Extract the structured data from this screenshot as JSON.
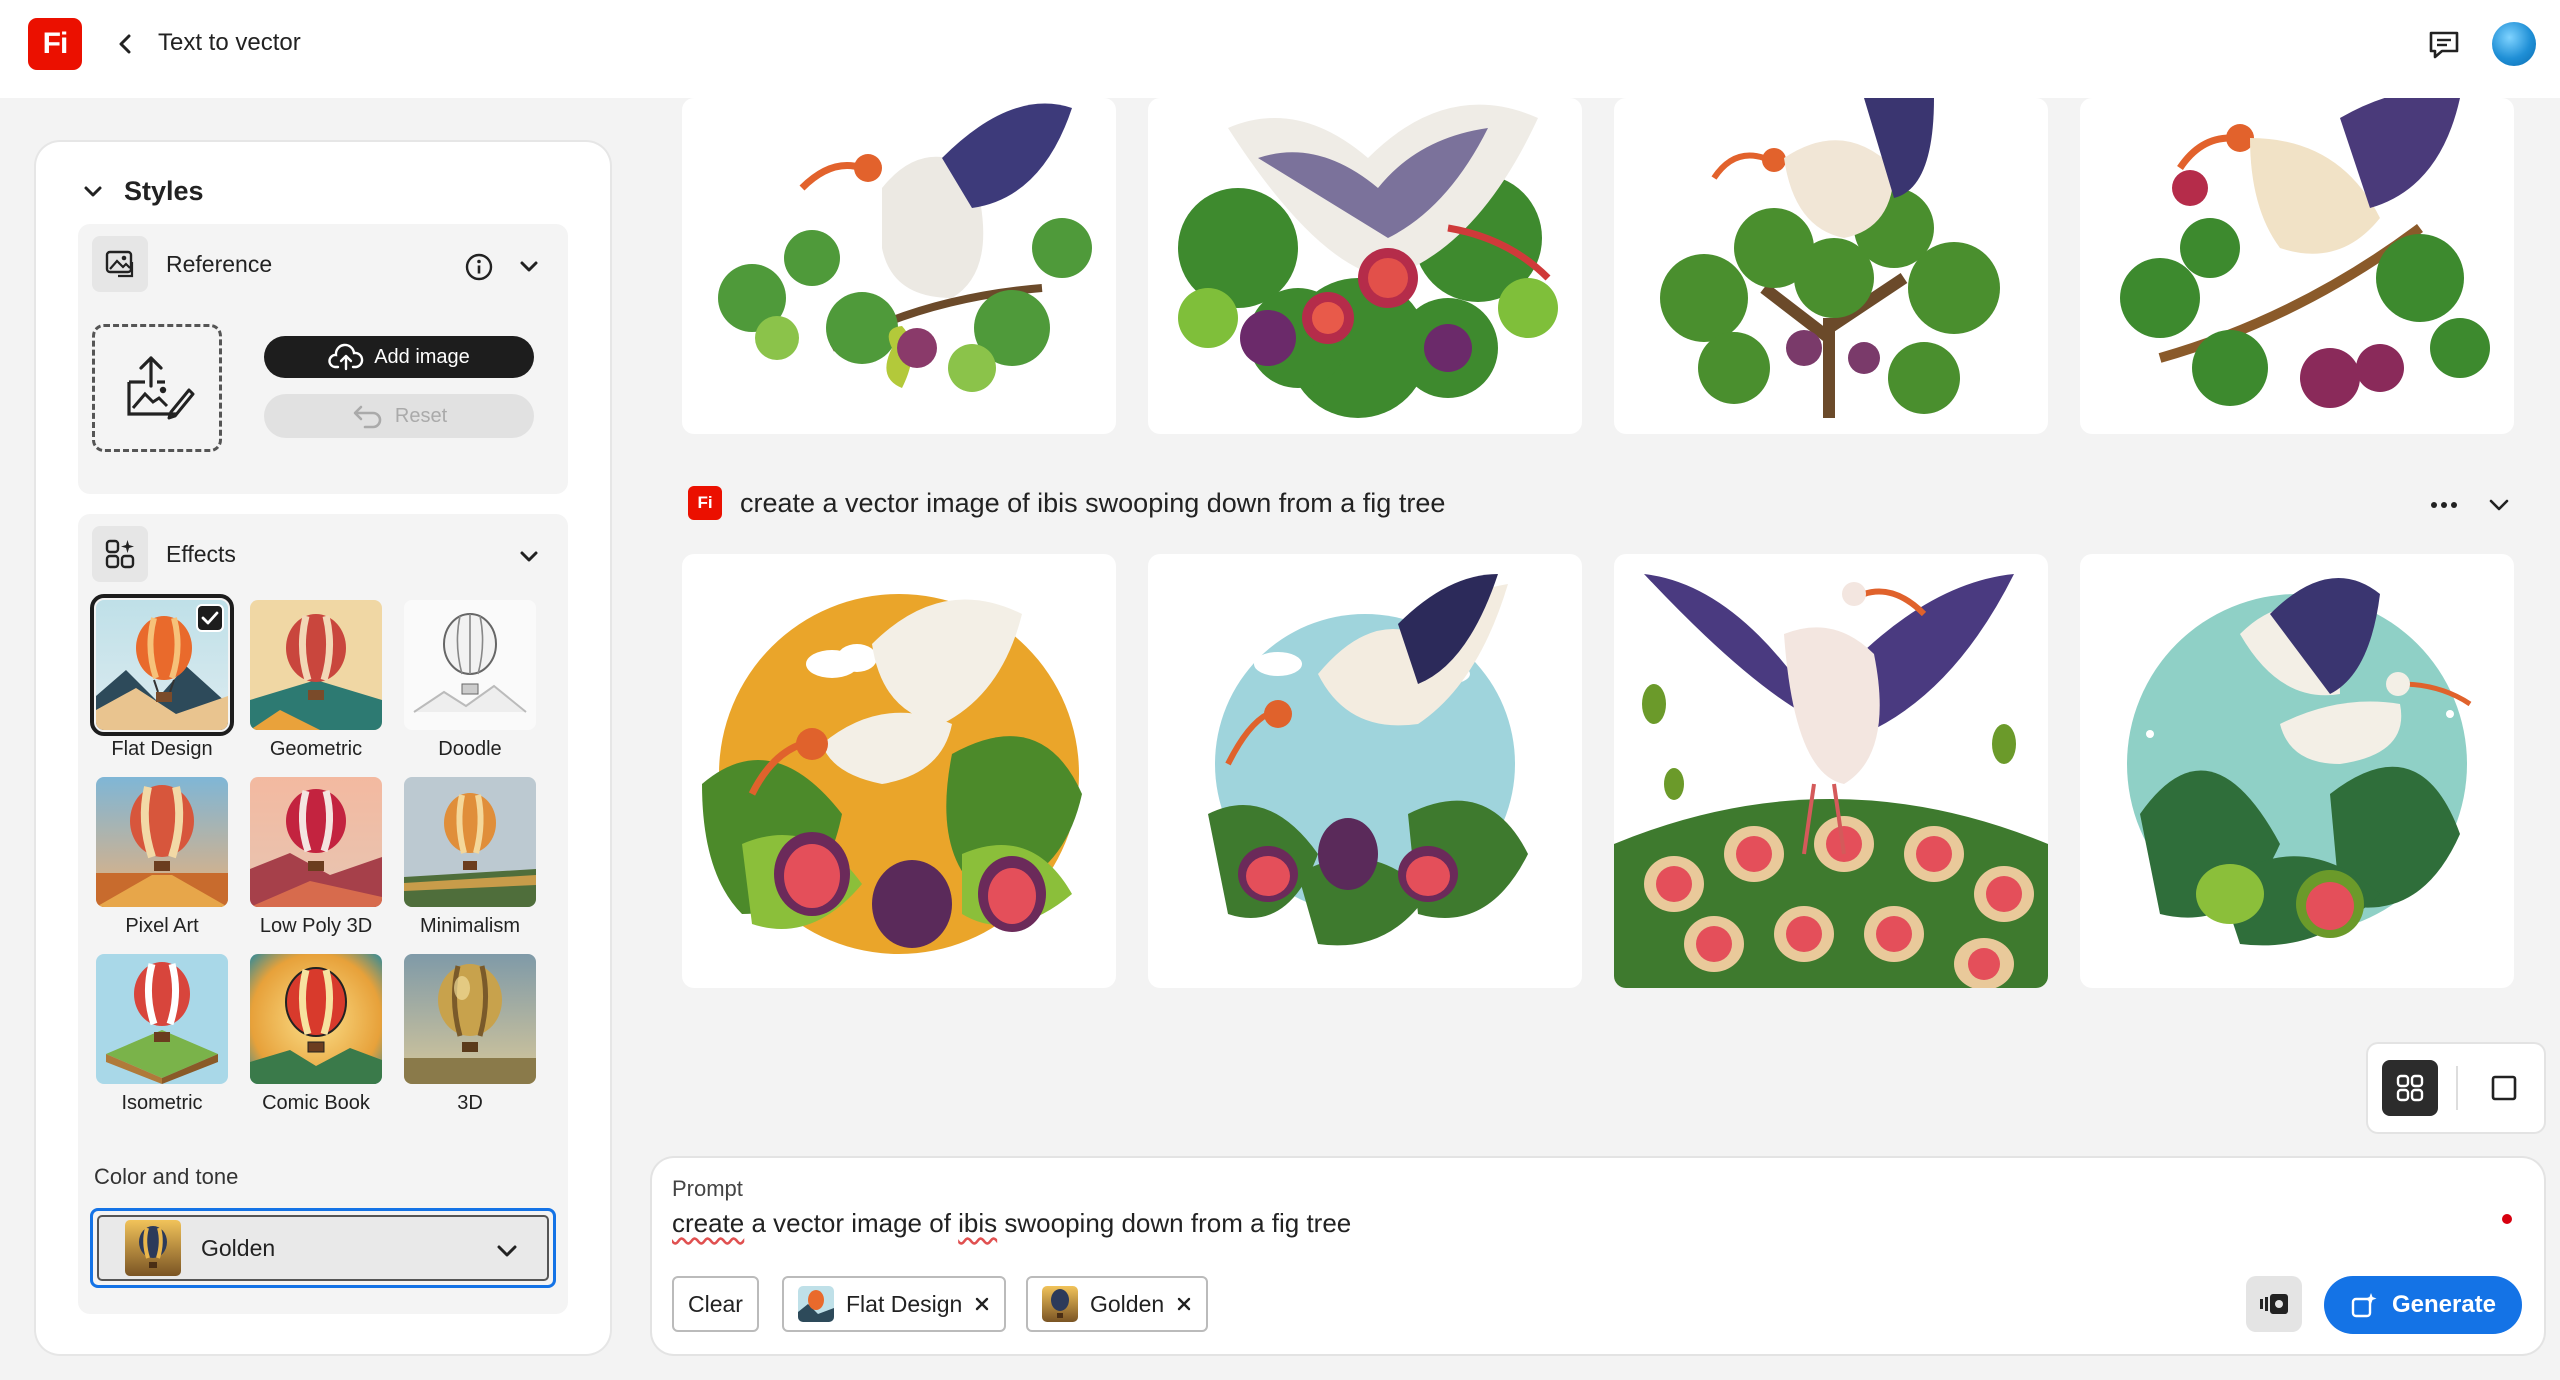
{
  "header": {
    "logo_text": "Fi",
    "title": "Text to vector",
    "icons": [
      "chevron-left-icon",
      "comment-icon",
      "avatar"
    ]
  },
  "sidebar": {
    "section_title": "Styles",
    "reference": {
      "label": "Reference",
      "add_image_label": "Add image",
      "reset_label": "Reset"
    },
    "effects": {
      "label": "Effects",
      "items": [
        {
          "label": "Flat Design",
          "selected": true
        },
        {
          "label": "Geometric",
          "selected": false
        },
        {
          "label": "Doodle",
          "selected": false
        },
        {
          "label": "Pixel Art",
          "selected": false
        },
        {
          "label": "Low Poly 3D",
          "selected": false
        },
        {
          "label": "Minimalism",
          "selected": false
        },
        {
          "label": "Isometric",
          "selected": false
        },
        {
          "label": "Comic Book",
          "selected": false
        },
        {
          "label": "3D",
          "selected": false
        }
      ]
    },
    "color_tone": {
      "label": "Color and tone",
      "value": "Golden"
    }
  },
  "gallery": {
    "prompt_heading": "create a vector image of ibis swooping down from a fig tree",
    "badge_text": "Fi"
  },
  "prompt_panel": {
    "label": "Prompt",
    "text_parts": [
      "create",
      " a vector image of ",
      "ibis",
      " swooping down from a fig tree"
    ],
    "clear_label": "Clear",
    "chips": [
      {
        "label": "Flat Design"
      },
      {
        "label": "Golden"
      }
    ],
    "generate_label": "Generate"
  },
  "colors": {
    "brand_red": "#eb1000",
    "accent_blue": "#1473e6",
    "dark": "#1d1d1d"
  }
}
